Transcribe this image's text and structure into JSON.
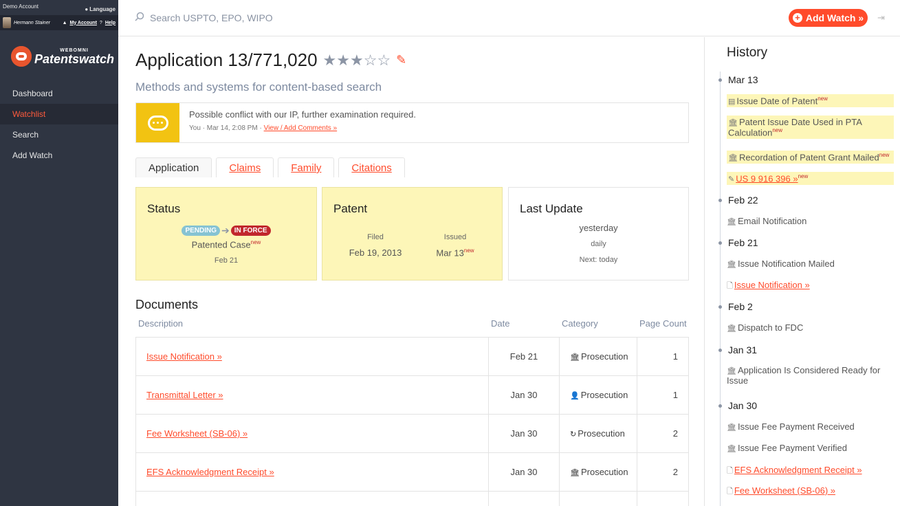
{
  "account": {
    "name": "Demo Account",
    "language": "Language",
    "user": "Hermann Stainer",
    "my_account": "My Account",
    "help": "Help"
  },
  "logo": {
    "small": "WEBOMNI",
    "big": "Patentswatch"
  },
  "nav": [
    {
      "label": "Dashboard"
    },
    {
      "label": "Watchlist"
    },
    {
      "label": "Search"
    },
    {
      "label": "Add Watch"
    }
  ],
  "search": {
    "placeholder": "Search USPTO, EPO, WIPO"
  },
  "add_watch_label": "Add Watch »",
  "application": {
    "title": "Application 13/771,020",
    "stars": "★★★☆☆",
    "rating": 3,
    "subtitle": "Methods and systems for content-based search"
  },
  "comment": {
    "text": "Possible conflict with our IP, further examination required.",
    "meta": "You · Mar 14, 2:08 PM · ",
    "link": "View / Add Comments »"
  },
  "tabs": [
    {
      "label": "Application"
    },
    {
      "label": "Claims"
    },
    {
      "label": "Family"
    },
    {
      "label": "Citations"
    }
  ],
  "status": {
    "title": "Status",
    "from": "PENDING",
    "to": "IN FORCE",
    "case": "Patented Case",
    "new": "new",
    "date": "Feb 21"
  },
  "patent": {
    "title": "Patent",
    "filed_label": "Filed",
    "filed": "Feb 19, 2013",
    "issued_label": "Issued",
    "issued": "Mar 13",
    "new": "new"
  },
  "last_update": {
    "title": "Last Update",
    "when": "yesterday",
    "freq": "daily",
    "next": "Next: today"
  },
  "documents": {
    "title": "Documents",
    "headers": {
      "description": "Description",
      "date": "Date",
      "category": "Category",
      "count": "Page Count"
    },
    "rows": [
      {
        "desc": "Issue Notification »",
        "date": "Feb 21",
        "icon": "bank-icon",
        "category": "Prosecution",
        "count": "1"
      },
      {
        "desc": "Transmittal Letter »",
        "date": "Jan 30",
        "icon": "user-icon",
        "category": "Prosecution",
        "count": "1"
      },
      {
        "desc": "Fee Worksheet (SB-06) »",
        "date": "Jan 30",
        "icon": "refresh-icon",
        "category": "Prosecution",
        "count": "2"
      },
      {
        "desc": "EFS Acknowledgment Receipt »",
        "date": "Jan 30",
        "icon": "bank-icon",
        "category": "Prosecution",
        "count": "2"
      }
    ]
  },
  "history": {
    "title": "History",
    "new": "new",
    "groups": [
      {
        "date": "Mar 13",
        "items": [
          {
            "text": "Issue Date of Patent",
            "new": true,
            "link": false
          },
          {
            "text": "Patent Issue Date Used in PTA Calculation",
            "new": true,
            "link": false
          },
          {
            "text": "Recordation of Patent Grant Mailed",
            "new": true,
            "link": false
          },
          {
            "text": "US 9 916 396 »",
            "new": true,
            "link": true
          }
        ]
      },
      {
        "date": "Feb 22",
        "items": [
          {
            "text": "Email Notification"
          }
        ]
      },
      {
        "date": "Feb 21",
        "items": [
          {
            "text": "Issue Notification Mailed"
          },
          {
            "text": "Issue Notification »"
          }
        ]
      },
      {
        "date": "Feb 2",
        "items": [
          {
            "text": "Dispatch to FDC"
          }
        ]
      },
      {
        "date": "Jan 31",
        "items": [
          {
            "text": "Application Is Considered Ready for Issue"
          }
        ]
      },
      {
        "date": "Jan 30",
        "items": [
          {
            "text": "Issue Fee Payment Received"
          },
          {
            "text": "Issue Fee Payment Verified"
          },
          {
            "text": "EFS Acknowledgment Receipt »"
          },
          {
            "text": "Fee Worksheet (SB-06) »"
          }
        ]
      }
    ]
  },
  "colors": {
    "accent": "#ff4b2b",
    "sidebar": "#2f3542",
    "highlight": "#fdf6b8"
  }
}
